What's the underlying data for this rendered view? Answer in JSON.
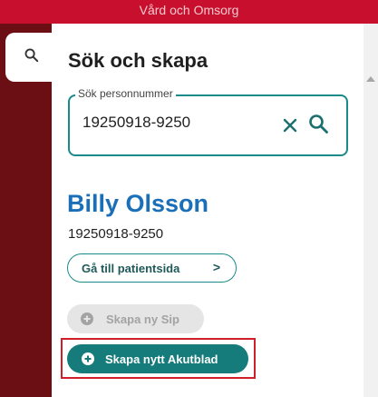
{
  "header": {
    "title": "Vård och Omsorg"
  },
  "panel": {
    "title": "Sök och skapa",
    "search": {
      "label": "Sök personnummer",
      "value": "19250918-9250"
    },
    "patient": {
      "name": "Billy Olsson",
      "personnummer": "19250918-9250"
    },
    "actions": {
      "goto_patient": "Gå till patientsida",
      "goto_chevron": ">",
      "new_sip": "Skapa ny Sip",
      "new_akutblad": "Skapa nytt Akutblad"
    }
  },
  "colors": {
    "header_red": "#c8102e",
    "sidebar_dark_red": "#6b0f14",
    "accent_teal": "#167b7b",
    "patient_blue": "#1a6fb8",
    "highlight_red": "#d11f2a"
  },
  "icons": {
    "tab": "search-icon",
    "clear": "close-icon",
    "search": "search-icon",
    "add": "plus-circle-icon"
  }
}
